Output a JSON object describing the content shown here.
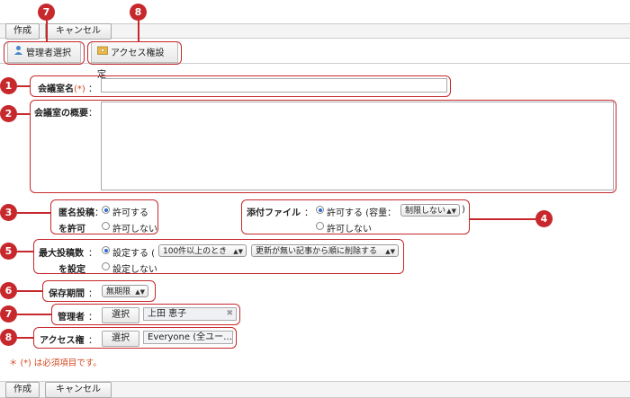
{
  "toolbar": {
    "create_label": "作成",
    "cancel_label": "キャンセル"
  },
  "tabs": {
    "manager_select": "管理者選択",
    "access_settings": "アクセス権設定"
  },
  "callouts": [
    "1",
    "2",
    "3",
    "4",
    "5",
    "6",
    "7",
    "8"
  ],
  "form": {
    "room_name_label": "会議室名",
    "required_mark": "(*)",
    "colon": "：",
    "room_desc_label": "会議室の概要",
    "anon_label_1": "匿名投稿",
    "anon_label_2": "を許可",
    "anon_allow": "許可する",
    "anon_deny": "許可しない",
    "attach_label": "添付ファイル",
    "attach_allow": "許可する (容量：",
    "attach_size": "制限しない",
    "attach_close": ")",
    "attach_deny": "許可しない",
    "maxpost_label_1": "最大投稿数",
    "maxpost_label_2": "を設定",
    "maxpost_set": "設定する (",
    "maxpost_count": "100件以上のとき",
    "maxpost_action": "更新が無い記事から順に削除する",
    "maxpost_unset": "設定しない",
    "period_label": "保存期間",
    "period_value": "無期限",
    "manager_label": "管理者",
    "select_btn": "選択",
    "manager_value": "上田 恵子",
    "access_label": "アクセス権",
    "access_value": "Everyone (全ユー…",
    "required_note": "＊ (*) は必須項目です。"
  },
  "colors": {
    "accent": "#c6282c",
    "radio_on": "#2a6bd1",
    "required": "#d2461e"
  }
}
